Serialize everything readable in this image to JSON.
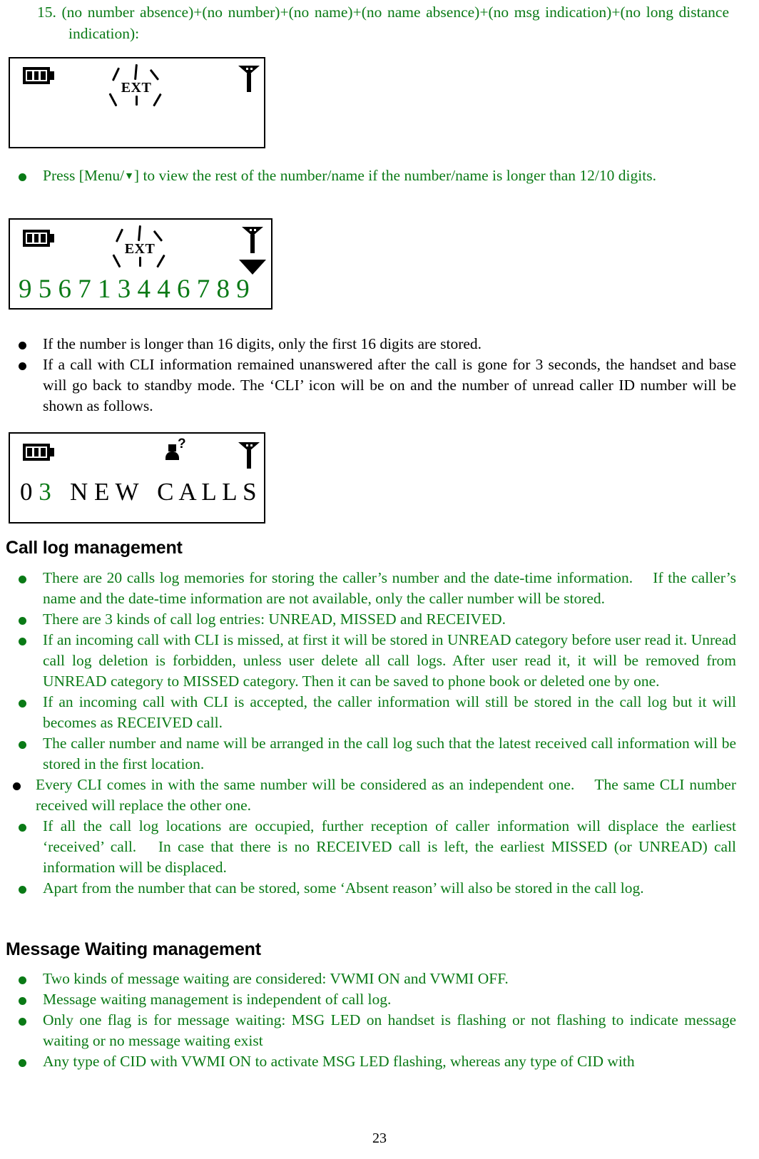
{
  "document": {
    "page_number": "23"
  },
  "intro": {
    "number": "15.",
    "text": "(no number absence)+(no number)+(no name)+(no name absence)+(no msg indication)+(no long distance indication):"
  },
  "lcd_1": {
    "name": "lcd-display-ext-only",
    "battery_icon": "battery-icon",
    "battery_bars": 3,
    "ext_label": "EXT",
    "ext_flashing": true,
    "antenna_icon": "antenna-icon",
    "line1": "",
    "line2": ""
  },
  "bullet_menu": {
    "prefix": "Press [Menu/",
    "arrow": "▼",
    "suffix": "] to view the rest of the number/name if the number/name is longer than 12/10 digits."
  },
  "lcd_2": {
    "name": "lcd-display-caller-number",
    "battery_icon": "battery-icon",
    "battery_bars": 3,
    "ext_label": "EXT",
    "ext_flashing": true,
    "antenna_icon": "antenna-icon",
    "down_arrow_icon": "down-triangle-icon",
    "number_line": "9 5 6 7 1 3 4 4 6 7 8 9"
  },
  "bullets_mid": [
    {
      "color": "black",
      "text": "If the number is longer than 16 digits, only the first 16 digits are stored."
    },
    {
      "color": "black",
      "text": "If a call with CLI information remained unanswered after the call is gone for 3 seconds, the handset and base will go back to standby mode. The ‘CLI’ icon will be on and the number of unread caller ID number will be shown as follows."
    }
  ],
  "lcd_3": {
    "name": "lcd-display-new-calls",
    "battery_icon": "battery-icon",
    "battery_bars": 3,
    "cli_icon": "cli-unread-caller-icon",
    "antenna_icon": "antenna-icon",
    "count_black": "0",
    "count_green": "3",
    "message": "N E W   C A L L S"
  },
  "section_call_log": {
    "heading": "Call log management",
    "bullets": [
      {
        "color": "green",
        "style": "normal",
        "text": "There are 20 calls log memories for storing the caller’s number and the date-time information.  If the caller’s name and the date-time information are not available, only the caller number will be stored."
      },
      {
        "color": "green",
        "style": "normal",
        "text": "There are 3 kinds of call log entries: UNREAD, MISSED and RECEIVED."
      },
      {
        "color": "green",
        "style": "normal",
        "text": "If an incoming call with CLI is missed, at first it will be stored in UNREAD category before user read it. Unread call log deletion is forbidden, unless user delete all call logs. After user read it, it will be removed from UNREAD category to MISSED category. Then it can be saved to phone book or deleted one by one."
      },
      {
        "color": "green",
        "style": "normal",
        "text": "If an incoming call with CLI is accepted, the caller information will still be stored in the call log but it will becomes as RECEIVED call."
      },
      {
        "color": "green",
        "style": "normal",
        "text": "The caller number and name will be arranged in the call log such that the latest received call information will be stored in the first location."
      },
      {
        "color": "green",
        "style": "alt",
        "bullet_color": "black",
        "text": "Every CLI comes in with the same number will be considered as an independent one.  The same CLI number received will replace the other one."
      },
      {
        "color": "green",
        "style": "normal",
        "text": "If all the call log locations are occupied, further reception of caller information will displace the earliest ‘received’ call.  In case that there is no RECEIVED call is left, the earliest MISSED (or UNREAD) call information will be displaced."
      },
      {
        "color": "green",
        "style": "normal",
        "text": "Apart from the number that can be stored, some ‘Absent reason’ will also be stored in the call log."
      }
    ]
  },
  "section_message_waiting": {
    "heading": "Message Waiting management",
    "bullets": [
      {
        "color": "green",
        "text": "Two kinds of message waiting are considered: VWMI ON and VWMI OFF."
      },
      {
        "color": "green",
        "text": "Message waiting management is independent of call log."
      },
      {
        "color": "green",
        "text": "Only one flag is for message waiting: MSG LED on handset is flashing or not flashing to indicate message waiting or no message waiting exist"
      },
      {
        "color": "green",
        "text": "Any type of CID with VWMI ON to activate MSG LED flashing, whereas any type of CID with"
      }
    ]
  },
  "colors": {
    "green": "#0a7a16",
    "black": "#000000"
  }
}
